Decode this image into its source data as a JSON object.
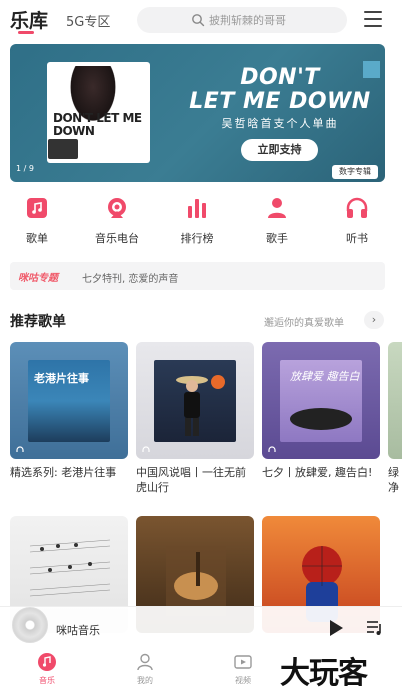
{
  "header": {
    "tab_main": "乐库",
    "tab_5g": "5G专区",
    "search_placeholder": "披荆斩棘的哥哥"
  },
  "banner": {
    "album_text": "DON'T LET ME DOWN",
    "title_line1": "DON'T",
    "title_line2": "LET ME DOWN",
    "subtitle": "吴哲晗首支个人单曲",
    "button": "立即支持",
    "tag": "数字专辑",
    "pager": "1 / 9"
  },
  "categories": [
    {
      "label": "歌单",
      "icon": "playlist-icon"
    },
    {
      "label": "音乐电台",
      "icon": "radio-icon"
    },
    {
      "label": "排行榜",
      "icon": "chart-icon"
    },
    {
      "label": "歌手",
      "icon": "singer-icon"
    },
    {
      "label": "听书",
      "icon": "headphone-icon"
    }
  ],
  "promo": {
    "badge": "咪咕专题",
    "text": "七夕特刊, 恋爱的声音"
  },
  "section": {
    "title": "推荐歌单",
    "more": "邂逅你的真爱歌单",
    "more_arrow": "›"
  },
  "playlists": [
    {
      "name": "精选系列: 老港片往事",
      "cover_text": "老港片往事"
    },
    {
      "name": "中国风说唱丨一往无前虎山行",
      "cover_text": ""
    },
    {
      "name": "七夕丨放肆爱, 趣告白!",
      "cover_text": "放肆爱 趣告白"
    },
    {
      "name": "",
      "cover_text": ""
    },
    {
      "name": "",
      "cover_text": ""
    },
    {
      "name": "",
      "cover_text": ""
    }
  ],
  "peek_text": "绿净",
  "player": {
    "title": "咪咕音乐"
  },
  "bottom_nav": [
    {
      "label": "音乐",
      "icon": "music-icon",
      "active": true
    },
    {
      "label": "我的",
      "icon": "profile-icon",
      "active": false
    },
    {
      "label": "视频",
      "icon": "video-icon",
      "active": false
    }
  ],
  "watermark": "大玩客",
  "colors": {
    "accent": "#f04a6a",
    "banner_bg": "#2f6f87"
  }
}
